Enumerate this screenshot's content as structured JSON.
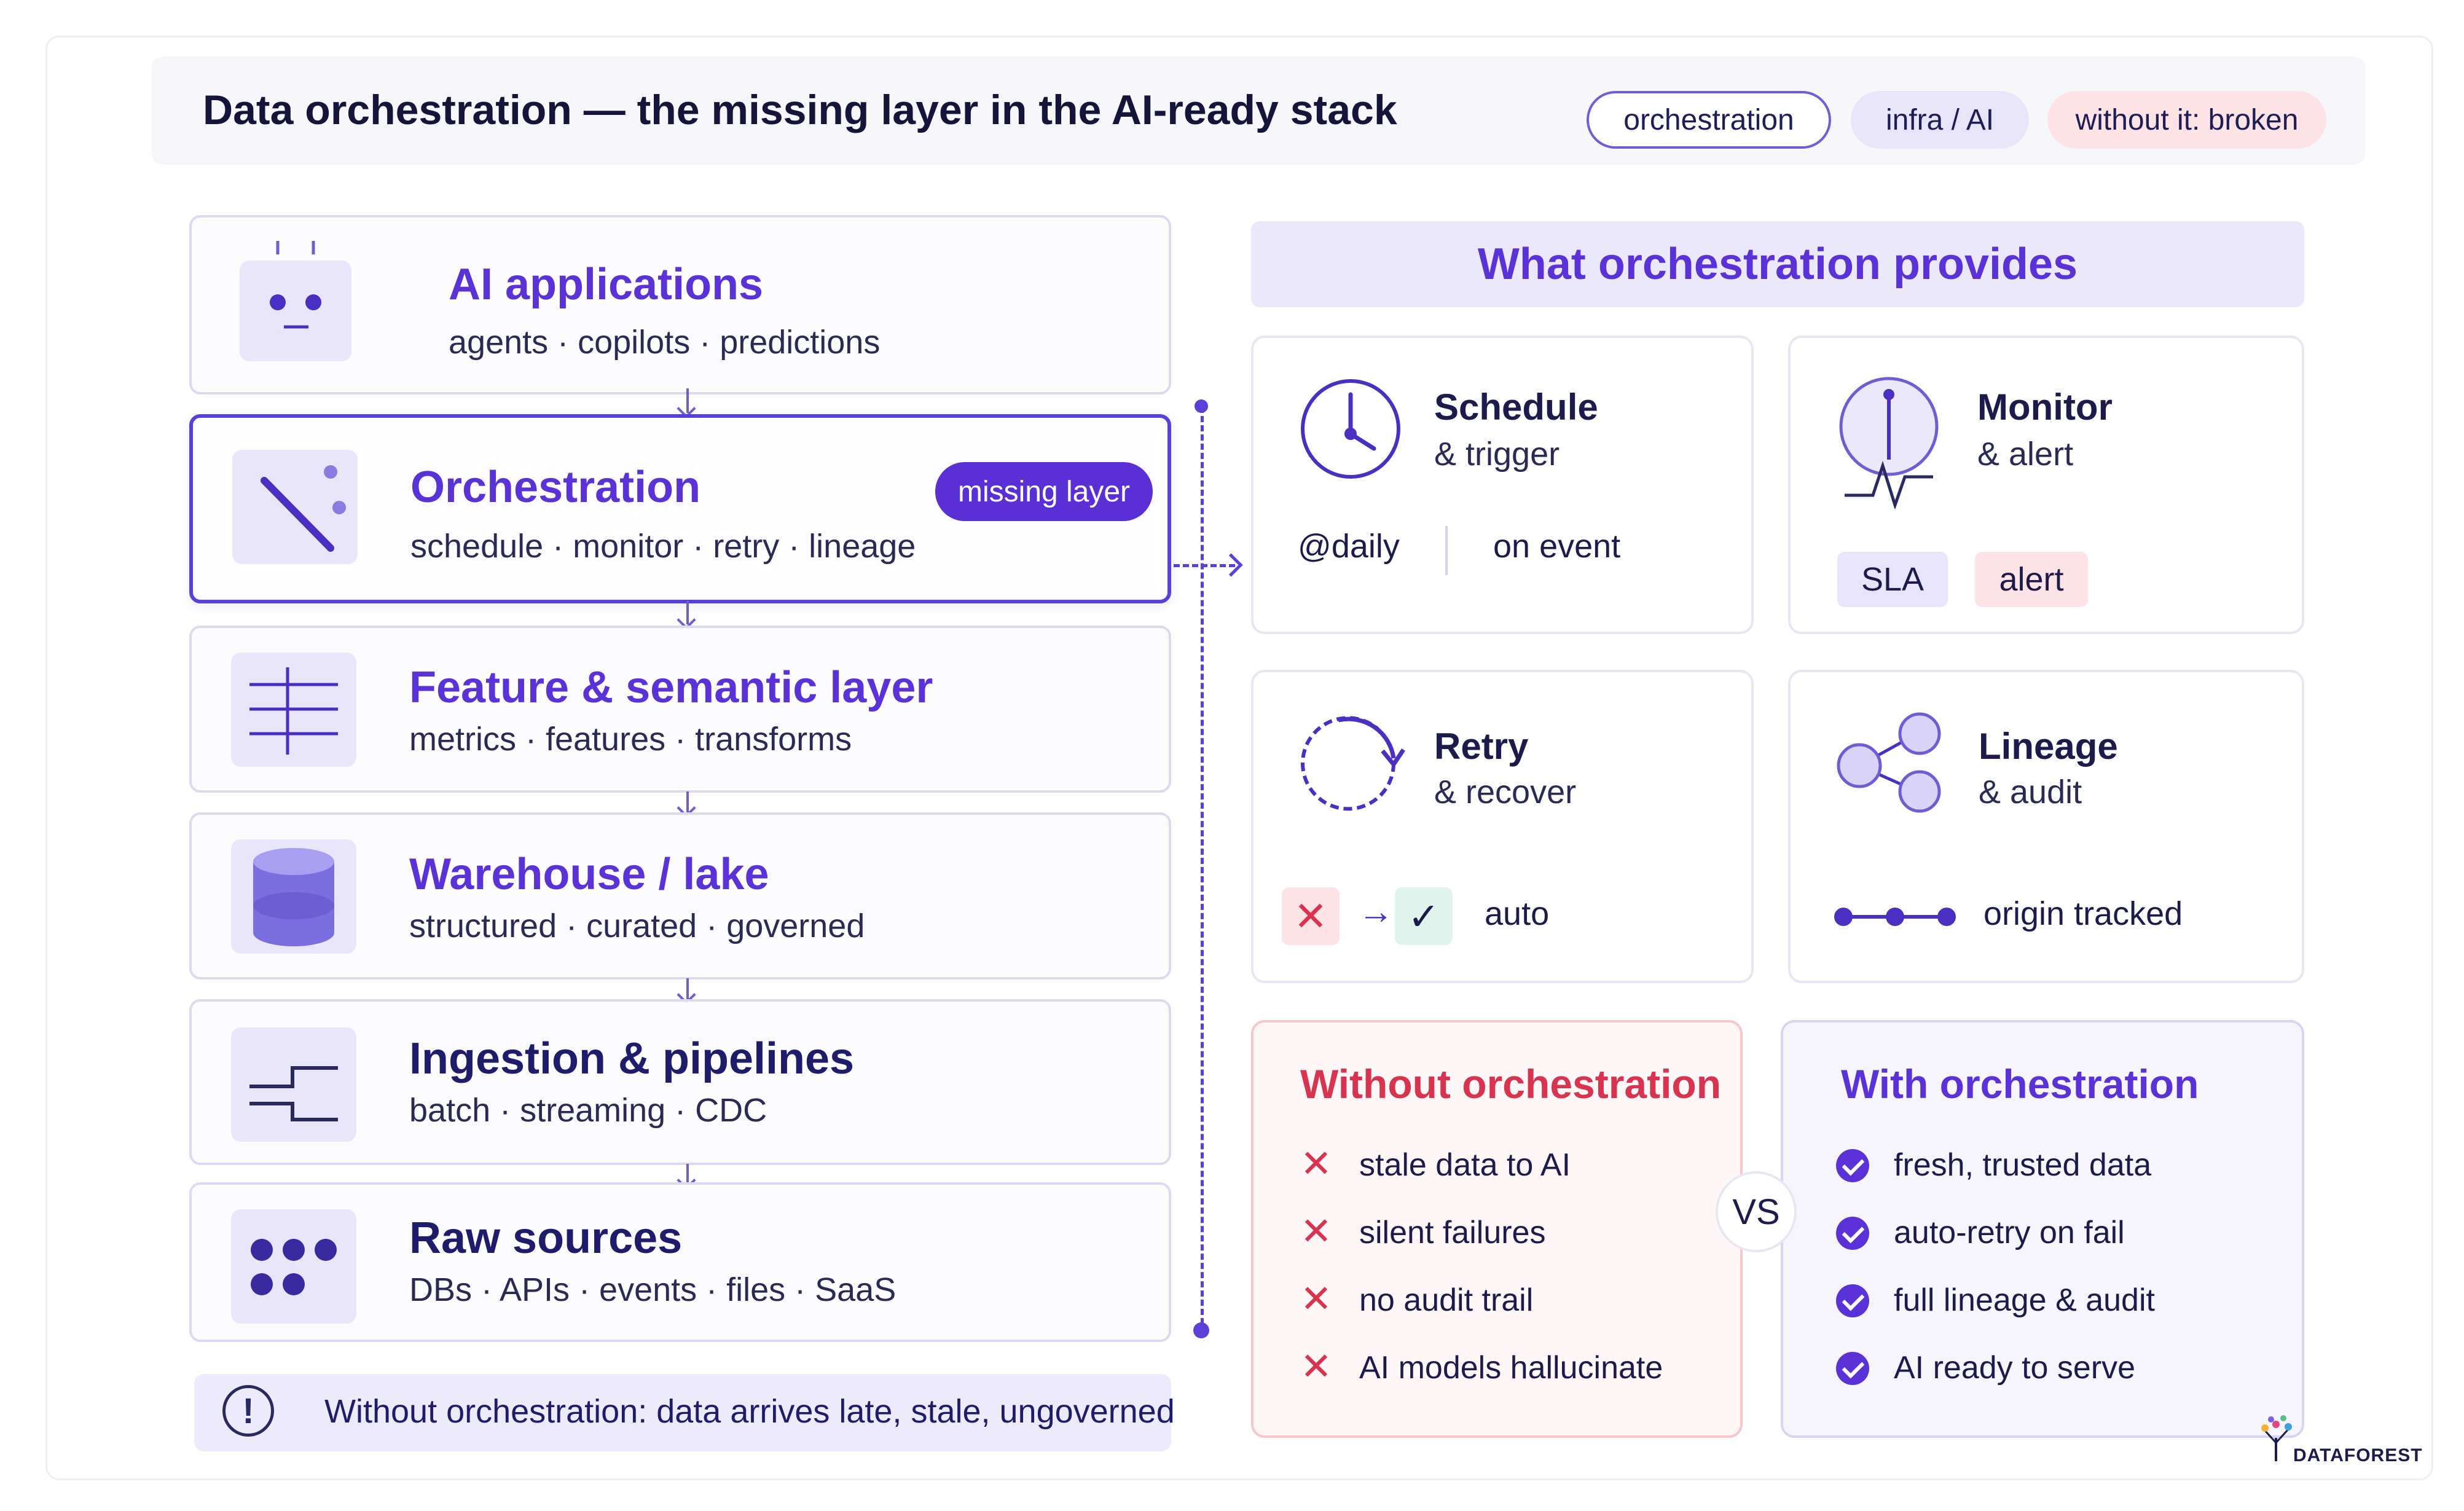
{
  "header": {
    "title": "Data orchestration — the missing layer in the AI-ready stack",
    "tags": [
      "orchestration",
      "infra / AI",
      "without it: broken"
    ]
  },
  "layers": [
    {
      "title": "AI applications",
      "subtitle": "agents · copilots · predictions",
      "icon": "robot-icon"
    },
    {
      "title": "Orchestration",
      "subtitle": "schedule · monitor · retry · lineage",
      "badge": "missing layer",
      "icon": "wand-icon"
    },
    {
      "title": "Feature & semantic layer",
      "subtitle": "metrics · features · transforms",
      "icon": "grid-icon"
    },
    {
      "title": "Warehouse / lake",
      "subtitle": "structured · curated · governed",
      "icon": "database-icon"
    },
    {
      "title": "Ingestion & pipelines",
      "subtitle": "batch · streaming · CDC",
      "icon": "pipeline-icon"
    },
    {
      "title": "Raw sources",
      "subtitle": "DBs · APIs · events · files · SaaS",
      "icon": "dots-icon"
    }
  ],
  "warning": "Without orchestration: data arrives late, stale, ungoverned",
  "provides": {
    "title": "What orchestration provides",
    "schedule": {
      "title": "Schedule",
      "subtitle": "& trigger",
      "opt1": "@daily",
      "opt2": "on event"
    },
    "monitor": {
      "title": "Monitor",
      "subtitle": "& alert",
      "pill1": "SLA",
      "pill2": "alert"
    },
    "retry": {
      "title": "Retry",
      "subtitle": "& recover",
      "label": "auto"
    },
    "lineage": {
      "title": "Lineage",
      "subtitle": "& audit",
      "label": "origin tracked"
    }
  },
  "without": {
    "title": "Without orchestration",
    "items": [
      "stale data to AI",
      "silent failures",
      "no audit trail",
      "AI models hallucinate"
    ]
  },
  "with": {
    "title": "With orchestration",
    "items": [
      "fresh, trusted data",
      "auto-retry on fail",
      "full lineage & audit",
      "AI ready to serve"
    ]
  },
  "vs": "VS",
  "brand": "DATAFOREST",
  "colors": {
    "accent": "#5a32d8",
    "danger": "#d8334f",
    "navy": "#1f1d6b"
  }
}
